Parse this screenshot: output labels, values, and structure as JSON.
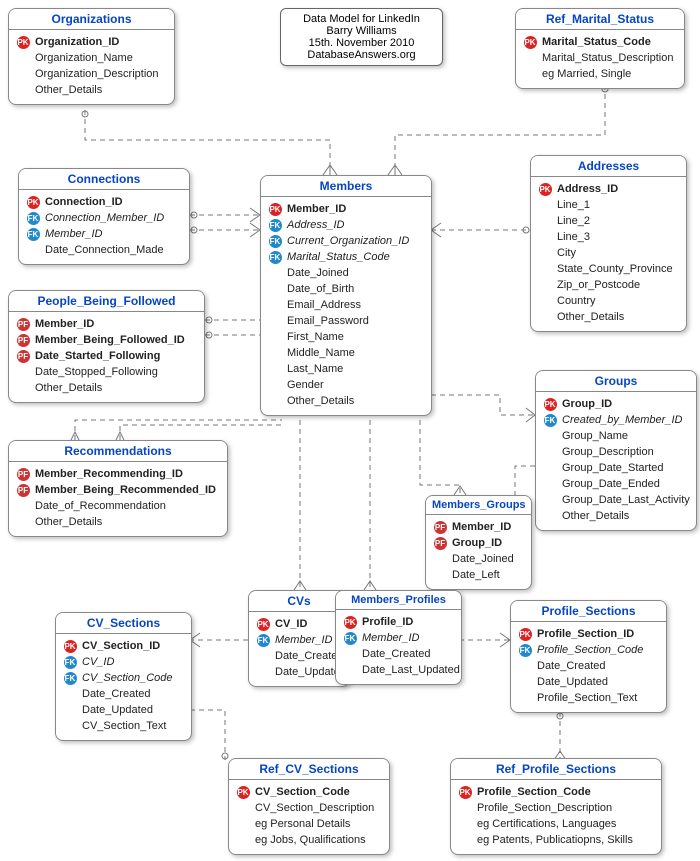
{
  "info": {
    "line1": "Data Model for LinkedIn",
    "line2": "Barry Williams",
    "line3": "15th. November 2010",
    "line4": "DatabaseAnswers.org"
  },
  "entities": {
    "organizations": {
      "title": "Organizations",
      "attrs": [
        {
          "key": "PK",
          "name": "Organization_ID",
          "b": true
        },
        {
          "key": "",
          "name": "Organization_Name"
        },
        {
          "key": "",
          "name": "Organization_Description"
        },
        {
          "key": "",
          "name": "Other_Details"
        }
      ]
    },
    "ref_marital": {
      "title": "Ref_Marital_Status",
      "attrs": [
        {
          "key": "PK",
          "name": "Marital_Status_Code",
          "b": true
        },
        {
          "key": "",
          "name": "Marital_Status_Description"
        },
        {
          "key": "",
          "name": "eg Married, Single"
        }
      ]
    },
    "connections": {
      "title": "Connections",
      "attrs": [
        {
          "key": "PK",
          "name": "Connection_ID",
          "b": true
        },
        {
          "key": "FK",
          "name": "Connection_Member_ID",
          "i": true
        },
        {
          "key": "FK",
          "name": "Member_ID",
          "i": true
        },
        {
          "key": "",
          "name": "Date_Connection_Made"
        }
      ]
    },
    "members": {
      "title": "Members",
      "attrs": [
        {
          "key": "PK",
          "name": "Member_ID",
          "b": true
        },
        {
          "key": "FK",
          "name": "Address_ID",
          "i": true
        },
        {
          "key": "FK",
          "name": "Current_Organization_ID",
          "i": true
        },
        {
          "key": "FK",
          "name": "Marital_Status_Code",
          "i": true
        },
        {
          "key": "",
          "name": "Date_Joined"
        },
        {
          "key": "",
          "name": "Date_of_Birth"
        },
        {
          "key": "",
          "name": "Email_Address"
        },
        {
          "key": "",
          "name": "Email_Password"
        },
        {
          "key": "",
          "name": "First_Name"
        },
        {
          "key": "",
          "name": "Middle_Name"
        },
        {
          "key": "",
          "name": "Last_Name"
        },
        {
          "key": "",
          "name": "Gender"
        },
        {
          "key": "",
          "name": "Other_Details"
        }
      ]
    },
    "addresses": {
      "title": "Addresses",
      "attrs": [
        {
          "key": "PK",
          "name": "Address_ID",
          "b": true
        },
        {
          "key": "",
          "name": "Line_1"
        },
        {
          "key": "",
          "name": "Line_2"
        },
        {
          "key": "",
          "name": "Line_3"
        },
        {
          "key": "",
          "name": "City"
        },
        {
          "key": "",
          "name": "State_County_Province"
        },
        {
          "key": "",
          "name": "Zip_or_Postcode"
        },
        {
          "key": "",
          "name": "Country"
        },
        {
          "key": "",
          "name": "Other_Details"
        }
      ]
    },
    "people_followed": {
      "title": "People_Being_Followed",
      "attrs": [
        {
          "key": "PF",
          "name": "Member_ID",
          "b": true
        },
        {
          "key": "PF",
          "name": "Member_Being_Followed_ID",
          "b": true
        },
        {
          "key": "PF",
          "name": "Date_Started_Following",
          "b": true
        },
        {
          "key": "",
          "name": "Date_Stopped_Following"
        },
        {
          "key": "",
          "name": "Other_Details"
        }
      ]
    },
    "groups": {
      "title": "Groups",
      "attrs": [
        {
          "key": "PK",
          "name": "Group_ID",
          "b": true
        },
        {
          "key": "FK",
          "name": "Created_by_Member_ID",
          "i": true
        },
        {
          "key": "",
          "name": "Group_Name"
        },
        {
          "key": "",
          "name": "Group_Description"
        },
        {
          "key": "",
          "name": "Group_Date_Started"
        },
        {
          "key": "",
          "name": "Group_Date_Ended"
        },
        {
          "key": "",
          "name": "Group_Date_Last_Activity"
        },
        {
          "key": "",
          "name": "Other_Details"
        }
      ]
    },
    "recommendations": {
      "title": "Recommendations",
      "attrs": [
        {
          "key": "PF",
          "name": "Member_Recommending_ID",
          "b": true
        },
        {
          "key": "PF",
          "name": "Member_Being_Recommended_ID",
          "b": true
        },
        {
          "key": "",
          "name": "Date_of_Recommendation"
        },
        {
          "key": "",
          "name": "Other_Details"
        }
      ]
    },
    "members_groups": {
      "title": "Members_Groups",
      "attrs": [
        {
          "key": "PF",
          "name": "Member_ID",
          "b": true
        },
        {
          "key": "PF",
          "name": "Group_ID",
          "b": true
        },
        {
          "key": "",
          "name": "Date_Joined"
        },
        {
          "key": "",
          "name": "Date_Left"
        }
      ]
    },
    "cvs": {
      "title": "CVs",
      "attrs": [
        {
          "key": "PK",
          "name": "CV_ID",
          "b": true
        },
        {
          "key": "FK",
          "name": "Member_ID",
          "i": true
        },
        {
          "key": "",
          "name": "Date_Created"
        },
        {
          "key": "",
          "name": "Date_Updated"
        }
      ]
    },
    "members_profiles": {
      "title": "Members_Profiles",
      "attrs": [
        {
          "key": "PK",
          "name": "Profile_ID",
          "b": true
        },
        {
          "key": "FK",
          "name": "Member_ID",
          "i": true
        },
        {
          "key": "",
          "name": "Date_Created"
        },
        {
          "key": "",
          "name": "Date_Last_Updated"
        }
      ]
    },
    "cv_sections": {
      "title": "CV_Sections",
      "attrs": [
        {
          "key": "PK",
          "name": "CV_Section_ID",
          "b": true
        },
        {
          "key": "FK",
          "name": "CV_ID",
          "i": true
        },
        {
          "key": "FK",
          "name": "CV_Section_Code",
          "i": true
        },
        {
          "key": "",
          "name": "Date_Created"
        },
        {
          "key": "",
          "name": "Date_Updated"
        },
        {
          "key": "",
          "name": "CV_Section_Text"
        }
      ]
    },
    "profile_sections": {
      "title": "Profile_Sections",
      "attrs": [
        {
          "key": "PK",
          "name": "Profile_Section_ID",
          "b": true
        },
        {
          "key": "FK",
          "name": "Profile_Section_Code",
          "i": true
        },
        {
          "key": "",
          "name": "Date_Created"
        },
        {
          "key": "",
          "name": "Date_Updated"
        },
        {
          "key": "",
          "name": "Profile_Section_Text"
        }
      ]
    },
    "ref_cv_sections": {
      "title": "Ref_CV_Sections",
      "attrs": [
        {
          "key": "PK",
          "name": "CV_Section_Code",
          "b": true
        },
        {
          "key": "",
          "name": "CV_Section_Description"
        },
        {
          "key": "",
          "name": "eg Personal Details"
        },
        {
          "key": "",
          "name": "eg Jobs, Qualifications"
        }
      ]
    },
    "ref_profile_sections": {
      "title": "Ref_Profile_Sections",
      "attrs": [
        {
          "key": "PK",
          "name": "Profile_Section_Code",
          "b": true
        },
        {
          "key": "",
          "name": "Profile_Section_Description"
        },
        {
          "key": "",
          "name": "eg Certifications, Languages"
        },
        {
          "key": "",
          "name": "eg Patents, Publicatiopns, Skills"
        }
      ]
    }
  }
}
